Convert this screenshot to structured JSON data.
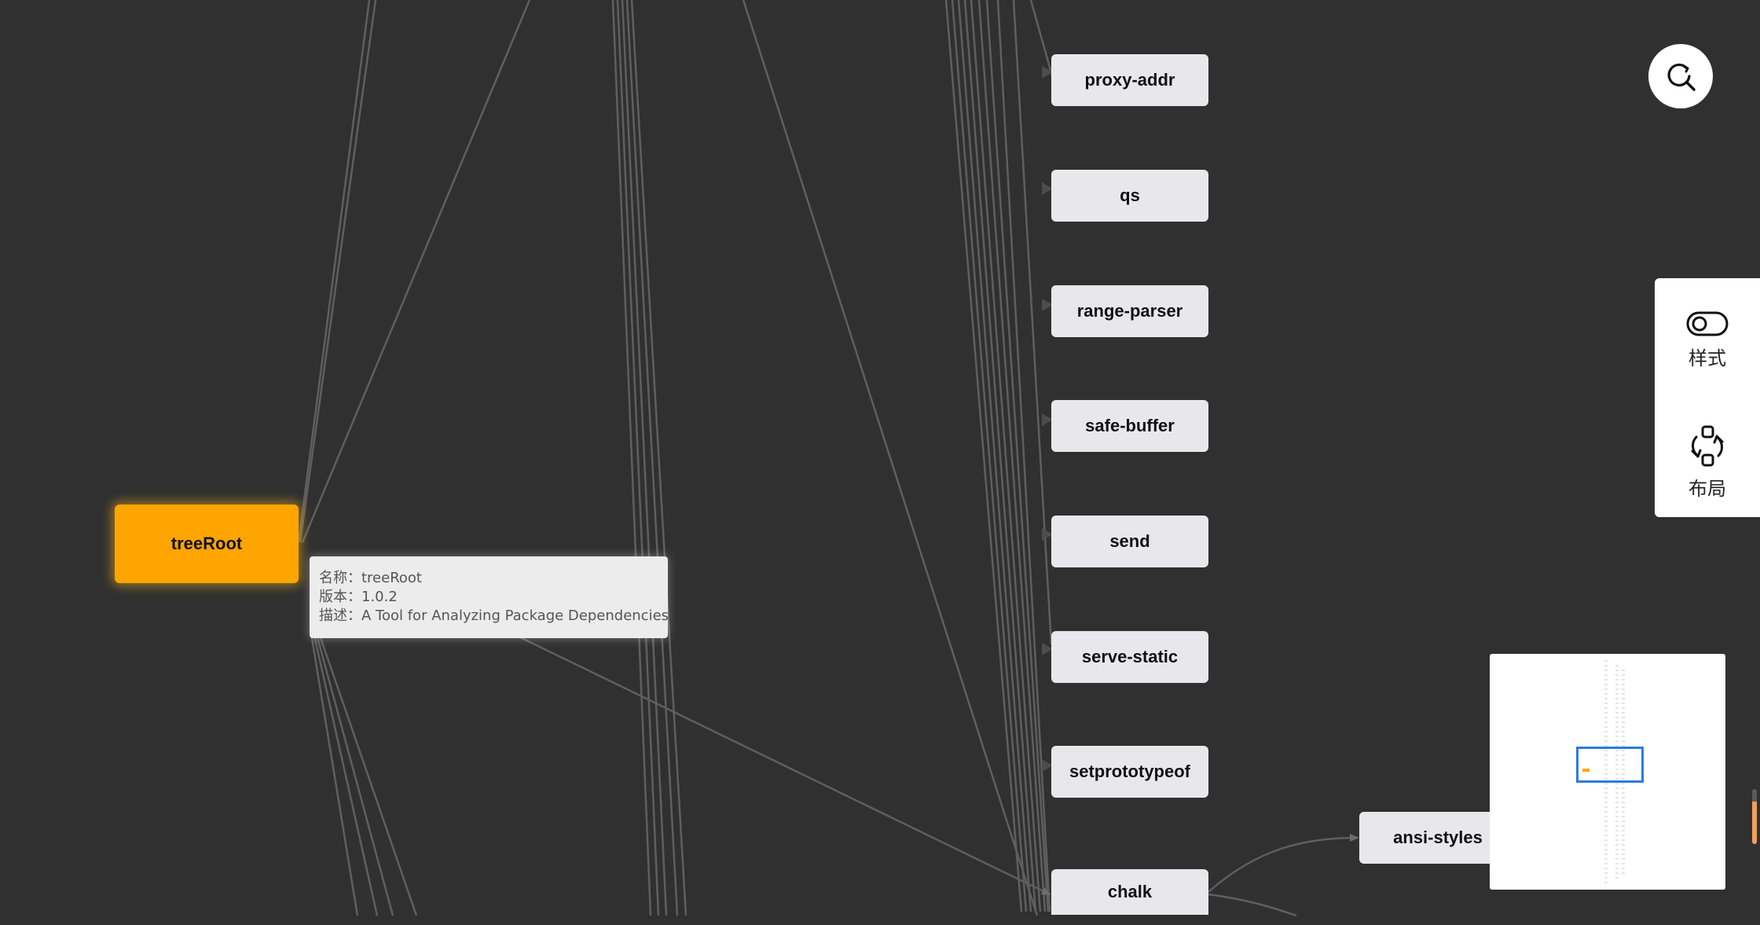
{
  "graph": {
    "root": {
      "label": "treeRoot"
    },
    "nodes": [
      {
        "id": "proxy-addr",
        "label": "proxy-addr"
      },
      {
        "id": "qs",
        "label": "qs"
      },
      {
        "id": "range-parser",
        "label": "range-parser"
      },
      {
        "id": "safe-buffer",
        "label": "safe-buffer"
      },
      {
        "id": "send",
        "label": "send"
      },
      {
        "id": "serve-static",
        "label": "serve-static"
      },
      {
        "id": "setprototypeof",
        "label": "setprototypeof"
      },
      {
        "id": "chalk",
        "label": "chalk"
      },
      {
        "id": "ansi-styles",
        "label": "ansi-styles"
      }
    ]
  },
  "tooltip": {
    "name_row": "名称：treeRoot",
    "version_row": "版本：1.0.2",
    "desc_row": "描述：A Tool for Analyzing Package Dependencies"
  },
  "toolbar": {
    "style_label": "样式",
    "layout_label": "布局"
  },
  "icons": {
    "search": "search-refresh-icon",
    "style": "toggle-icon",
    "layout": "layout-cycle-icon"
  },
  "colors": {
    "background": "#303030",
    "root_node": "#ffa500",
    "node": "#e8e8ec",
    "edge": "#6a6a6a",
    "minimap_viewport": "#2a7be4"
  }
}
